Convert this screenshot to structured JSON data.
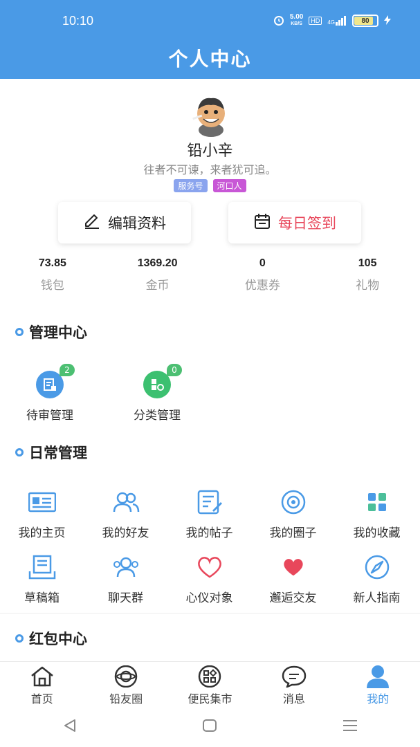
{
  "status_bar": {
    "time": "10:10",
    "net_speed": "5.00",
    "net_unit": "KB/S",
    "hd": "HD",
    "signal": "4G",
    "battery": "80"
  },
  "header": {
    "title": "个人中心"
  },
  "profile": {
    "name": "铅小辛",
    "motto": "往者不可谏，来者犹可追。",
    "tags": [
      "服务号",
      "河口人"
    ]
  },
  "actions": {
    "edit": "编辑资料",
    "checkin": "每日签到"
  },
  "stats": [
    {
      "value": "73.85",
      "label": "钱包"
    },
    {
      "value": "1369.20",
      "label": "金币"
    },
    {
      "value": "0",
      "label": "优惠券"
    },
    {
      "value": "105",
      "label": "礼物"
    }
  ],
  "management": {
    "title": "管理中心",
    "items": [
      {
        "label": "待审管理",
        "badge": "2"
      },
      {
        "label": "分类管理",
        "badge": "0"
      }
    ]
  },
  "daily": {
    "title": "日常管理",
    "items": [
      "我的主页",
      "我的好友",
      "我的帖子",
      "我的圈子",
      "我的收藏",
      "草稿箱",
      "聊天群",
      "心仪对象",
      "邂逅交友",
      "新人指南"
    ]
  },
  "redpacket": {
    "title": "红包中心"
  },
  "tabbar": {
    "items": [
      "首页",
      "铅友圈",
      "便民集市",
      "消息",
      "我的"
    ],
    "active": "我的"
  },
  "colors": {
    "primary": "#4a9ae6",
    "checkin": "#e8475b",
    "tag_service": "#8aa4ee",
    "tag_place": "#c857d6",
    "badge": "#4cbf72"
  }
}
